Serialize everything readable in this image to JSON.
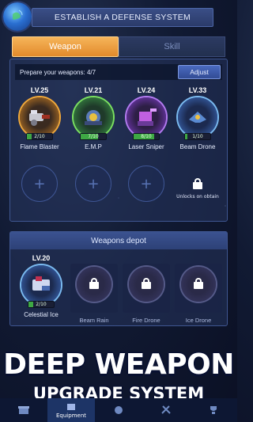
{
  "header": {
    "title": "ESTABLISH A DEFENSE SYSTEM",
    "globe_icon": "globe-icon"
  },
  "tabs": [
    {
      "label": "Weapon",
      "active": true
    },
    {
      "label": "Skill",
      "active": false
    }
  ],
  "prepare": {
    "text": "Prepare your weapons: 4/7",
    "adjust_label": "Adjust"
  },
  "equipped": [
    {
      "level": "LV.25",
      "name": "Flame Blaster",
      "progress": "2/10",
      "progress_value": 0.2,
      "rarity": "orange",
      "icon": "flame-blaster-icon"
    },
    {
      "level": "LV.21",
      "name": "E.M.P",
      "progress": "7/10",
      "progress_value": 0.7,
      "rarity": "green",
      "icon": "emp-icon"
    },
    {
      "level": "LV.24",
      "name": "Laser Sniper",
      "progress": "8/10",
      "progress_value": 0.8,
      "rarity": "purple",
      "icon": "laser-sniper-icon"
    },
    {
      "level": "LV.33",
      "name": "Beam Drone",
      "progress": "1/10",
      "progress_value": 0.1,
      "rarity": "blue",
      "icon": "beam-drone-icon"
    }
  ],
  "locked_slot_text": "Unlocks on obtain",
  "depot": {
    "title": "Weapons depot",
    "items": [
      {
        "level": "LV.20",
        "name": "Celestial Ice",
        "progress": "2/10",
        "progress_value": 0.2,
        "locked": false
      },
      {
        "name": "Beam Rain",
        "locked": true
      },
      {
        "name": "Fire Drone",
        "locked": true
      },
      {
        "name": "Ice Drone",
        "locked": true
      }
    ]
  },
  "promo": {
    "line1": "DEEP WEAPON",
    "line2": "UPGRADE SYSTEM"
  },
  "nav": [
    {
      "label": "",
      "icon": "shop-icon"
    },
    {
      "label": "Equipment",
      "icon": "equipment-icon",
      "active": true
    },
    {
      "label": "",
      "icon": "globe-nav-icon"
    },
    {
      "label": "",
      "icon": "swords-icon"
    },
    {
      "label": "",
      "icon": "trophy-icon"
    }
  ]
}
